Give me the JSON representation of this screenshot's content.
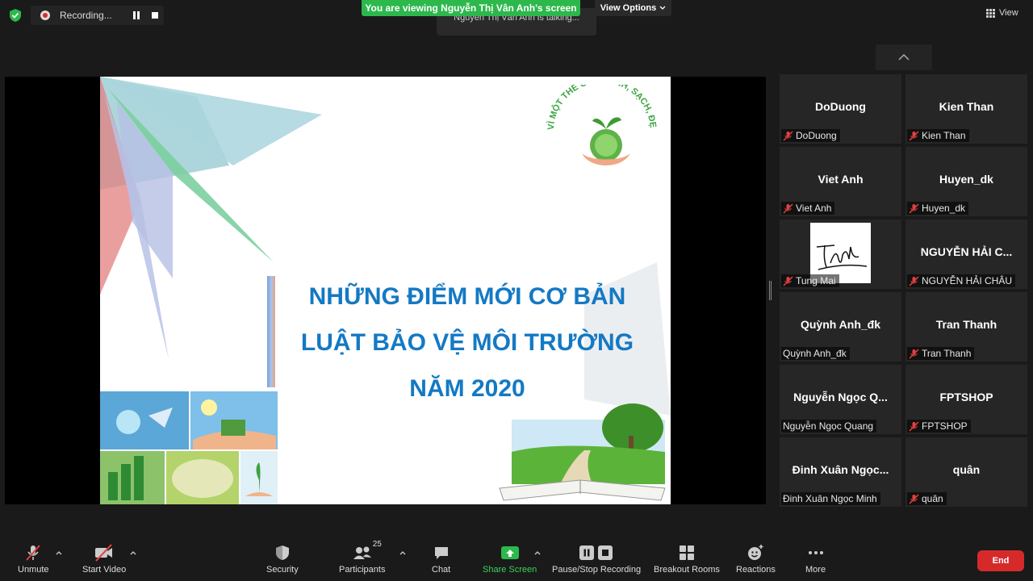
{
  "top": {
    "recording_label": "Recording...",
    "viewing_banner": "You are viewing Nguyễn Thị Vân Anh's screen",
    "talking_text": "Nguyễn Thị Vân Anh is talking...",
    "view_options_label": "View Options",
    "view_label": "View"
  },
  "slide": {
    "title_line1": "NHỮNG ĐIỂM MỚI CƠ BẢN",
    "title_line2": "LUẬT BẢO VỆ MÔI TRƯỜNG",
    "title_line3": "NĂM 2020",
    "logo_text": "VÌ MỘT THẾ GIỚI XANH, SẠCH, ĐẸP",
    "title_color": "#1479c4"
  },
  "gallery": [
    {
      "name": "DoDuong",
      "label": "DoDuong",
      "muted": true
    },
    {
      "name": "Kien Than",
      "label": "Kien Than",
      "muted": true
    },
    {
      "name": "Viet Anh",
      "label": "Viet Anh",
      "muted": true
    },
    {
      "name": "Huyen_dk",
      "label": "Huyen_dk",
      "muted": true
    },
    {
      "name": "",
      "label": "Tung Mai",
      "muted": true,
      "video": true
    },
    {
      "name": "NGUYỄN HẢI C...",
      "label": "NGUYỄN HẢI CHÂU",
      "muted": true
    },
    {
      "name": "Quỳnh Anh_đk",
      "label": "Quỳnh Anh_đk",
      "muted": false
    },
    {
      "name": "Tran Thanh",
      "label": "Tran Thanh",
      "muted": true
    },
    {
      "name": "Nguyễn Ngọc Q...",
      "label": "Nguyễn Ngọc Quang",
      "muted": false
    },
    {
      "name": "FPTSHOP",
      "label": "FPTSHOP",
      "muted": true
    },
    {
      "name": "Đinh Xuân Ngọc...",
      "label": "Đinh Xuân Ngọc Minh",
      "muted": false
    },
    {
      "name": "quân",
      "label": "quân",
      "muted": true
    }
  ],
  "toolbar": {
    "unmute": "Unmute",
    "start_video": "Start Video",
    "security": "Security",
    "participants": "Participants",
    "participant_count": "25",
    "chat": "Chat",
    "share_screen": "Share Screen",
    "pause_stop_recording": "Pause/Stop Recording",
    "breakout_rooms": "Breakout Rooms",
    "reactions": "Reactions",
    "more": "More",
    "end": "End"
  },
  "colors": {
    "share_green": "#3ed05b",
    "banner_green": "#2db84c",
    "end_red": "#d62a2a",
    "mute_red": "#e04040"
  }
}
